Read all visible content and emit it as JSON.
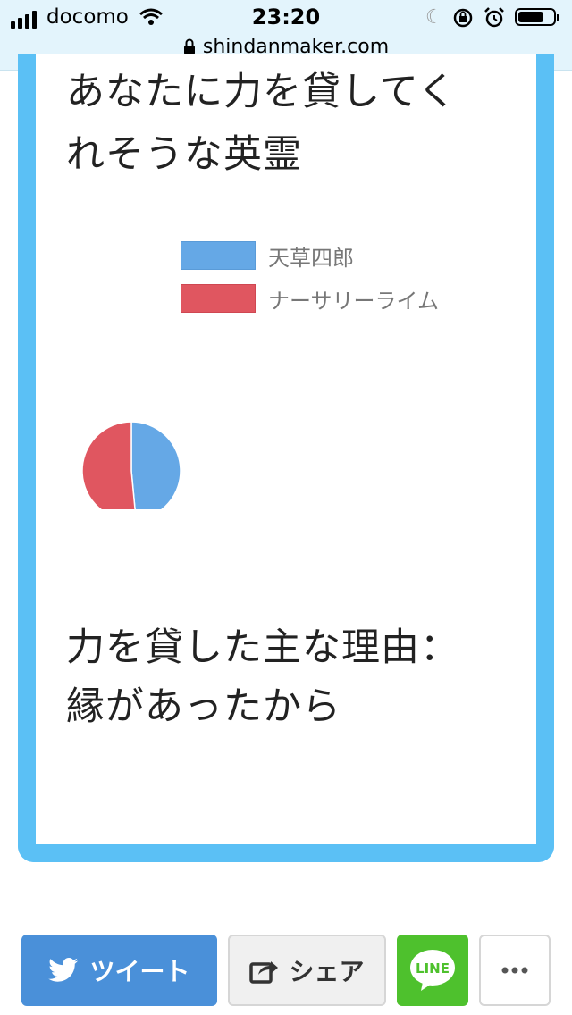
{
  "status_bar": {
    "carrier": "docomo",
    "time": "23:20",
    "url": "shindanmaker.com",
    "icons": [
      "signal-icon",
      "wifi-icon",
      "moon-icon",
      "orientation-lock-icon",
      "alarm-icon",
      "battery-icon"
    ]
  },
  "result": {
    "title": "あなたに力を貸してくれそうな英霊",
    "reason": "力を貸した主な理由：縁があったから"
  },
  "chart_data": {
    "type": "pie",
    "series": [
      {
        "name": "天草四郎",
        "value": 48.5,
        "color": "#65a8e6"
      },
      {
        "name": "ナーサリーライム",
        "value": 51.5,
        "color": "#e05660"
      }
    ]
  },
  "share_bar": {
    "tweet_label": "ツイート",
    "share_label": "シェア",
    "line_label": "LINE",
    "colors": {
      "tweet": "#4a90d9",
      "line": "#4ec12d",
      "frame": "#5bc0f5"
    }
  }
}
